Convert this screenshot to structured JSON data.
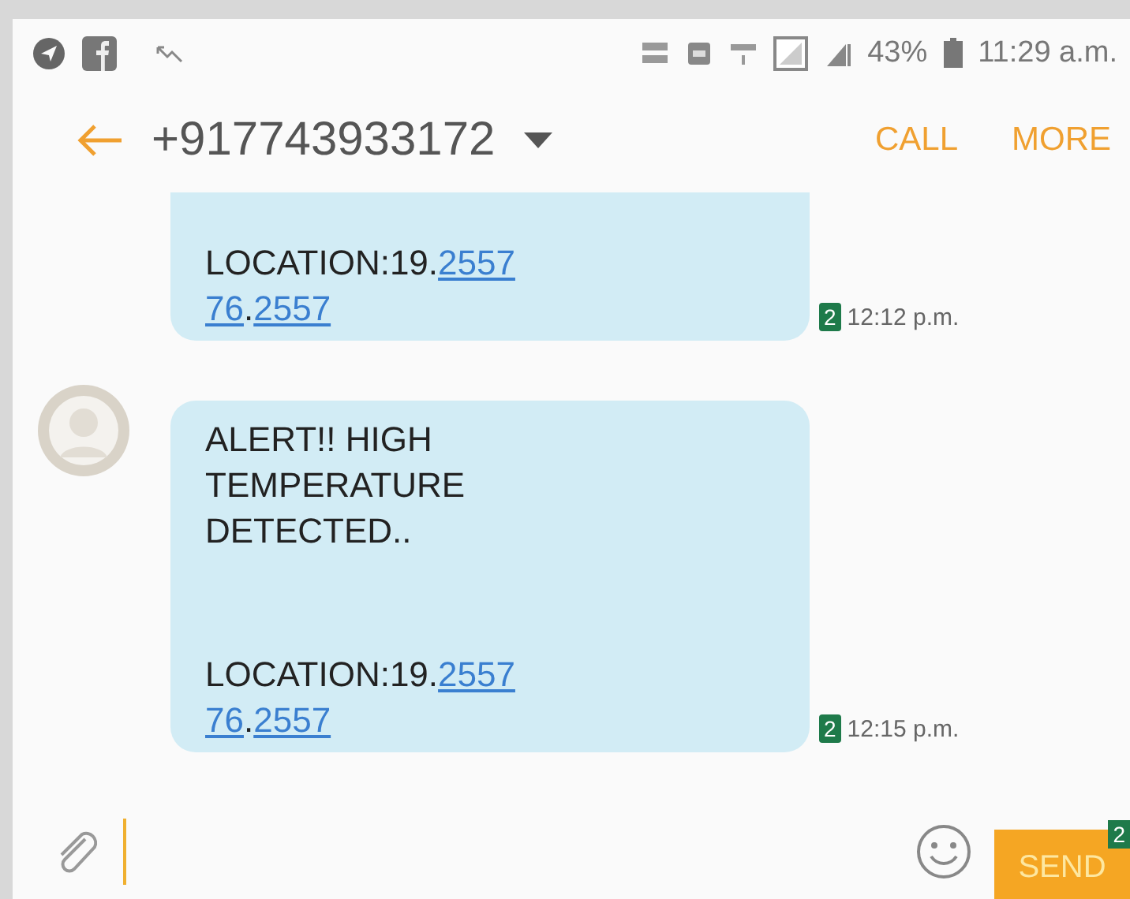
{
  "status_bar": {
    "battery": "43%",
    "time": "11:29 a.m."
  },
  "header": {
    "title": "+917743933172",
    "actions": [
      "CALL",
      "MORE"
    ]
  },
  "messages": [
    {
      "avatar": false,
      "cut_top": true,
      "paragraphs": [
        [
          [
            {
              "text": "LOCATION:19."
            },
            {
              "text": "2557",
              "link": true
            }
          ],
          [
            {
              "text": "76",
              "link": true
            },
            {
              "text": "."
            },
            {
              "text": "2557",
              "link": true
            }
          ]
        ]
      ],
      "sim": "2",
      "time": "12:12 p.m."
    },
    {
      "avatar": true,
      "cut_top": false,
      "paragraphs": [
        [
          [
            {
              "text": "ALERT!! HIGH"
            }
          ],
          [
            {
              "text": "TEMPERATURE"
            }
          ],
          [
            {
              "text": "DETECTED.."
            }
          ]
        ],
        [
          [
            {
              "text": "LOCATION:19."
            },
            {
              "text": "2557",
              "link": true
            }
          ],
          [
            {
              "text": "76",
              "link": true
            },
            {
              "text": "."
            },
            {
              "text": "2557",
              "link": true
            }
          ]
        ]
      ],
      "sim": "2",
      "time": "12:15 p.m."
    }
  ],
  "composer": {
    "send": "SEND",
    "sim": "2"
  }
}
